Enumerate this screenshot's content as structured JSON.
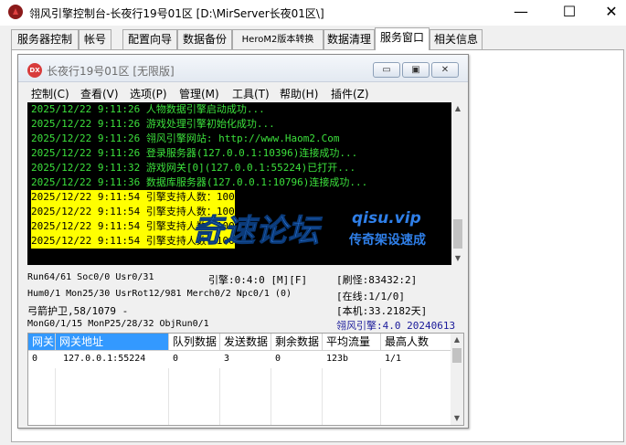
{
  "window": {
    "title": "翎风引擎控制台-长夜行19号01区 [D:\\MirServer长夜01区\\]",
    "minimize": "—",
    "maximize": "☐",
    "close": "✕"
  },
  "tabs": [
    {
      "label": "服务器控制"
    },
    {
      "label": "帐号"
    },
    {
      "label": "配置向导"
    },
    {
      "label": "数据备份"
    },
    {
      "label": "HeroM2版本转换"
    },
    {
      "label": "数据清理"
    },
    {
      "label": "服务窗口"
    },
    {
      "label": "相关信息"
    }
  ],
  "active_tab": "服务窗口",
  "inner_window": {
    "icon_text": "DX",
    "title": "长夜行19号01区 [无限版]",
    "min": "▭",
    "max": "▣",
    "close": "✕"
  },
  "menu": [
    {
      "label": "控制(C)"
    },
    {
      "label": "查看(V)"
    },
    {
      "label": "选项(P)"
    },
    {
      "label": "管理(M)"
    },
    {
      "label": "工具(T)"
    },
    {
      "label": "帮助(H)"
    },
    {
      "label": "插件(Z)"
    }
  ],
  "log": [
    {
      "text": "2025/12/22 9:11:26 人物数据引擎启动成功...",
      "highlight": false
    },
    {
      "text": "2025/12/22 9:11:26 游戏处理引擎初始化成功...",
      "highlight": false
    },
    {
      "text": "2025/12/22 9:11:26 翎风引擎网站: http://www.Haom2.Com",
      "highlight": false
    },
    {
      "text": "2025/12/22 9:11:26 登录服务器(127.0.0.1:10396)连接成功...",
      "highlight": false
    },
    {
      "text": "2025/12/22 9:11:32 游戏网关[0](127.0.0.1:55224)已打开...",
      "highlight": false
    },
    {
      "text": "2025/12/22 9:11:36 数据库服务器(127.0.0.1:10796)连接成功...",
      "highlight": false
    },
    {
      "text": "2025/12/22 9:11:54 引擎支持人数：100",
      "highlight": true
    },
    {
      "text": "2025/12/22 9:11:54 引擎支持人数：100",
      "highlight": true
    },
    {
      "text": "2025/12/22 9:11:54 引擎支持人数：100",
      "highlight": true
    },
    {
      "text": "2025/12/22 9:11:54 引擎支持人数：100",
      "highlight": true
    }
  ],
  "status": {
    "run": "Run64/61 Soc0/0 Usr0/31",
    "engine": "引擎:0:4:0 [M][F]",
    "monster": "[刷怪:83432:2]",
    "hum": "Hum0/1 Mon25/30 UsrRot12/981 Merch0/2 Npc0/1 (0)",
    "online": "[在线:1/1/0]",
    "guard": "弓箭护卫,58/1079 -",
    "local": "[本机:33.2182天]",
    "mongo": "MonG0/1/15 MonP25/28/32 ObjRun0/1",
    "version": "翎风引擎:4.0 20240613"
  },
  "grid": {
    "headers": [
      "网关",
      "网关地址",
      "队列数据",
      "发送数据",
      "剩余数据",
      "平均流量",
      "最高人数"
    ],
    "rows": [
      [
        "0",
        "127.0.0.1:55224",
        "0",
        "3",
        "0",
        "123b",
        "1/1"
      ]
    ]
  },
  "watermark": {
    "cn": "奇速论坛",
    "en": "qisu.vip",
    "sub": "传奇架设速成"
  }
}
